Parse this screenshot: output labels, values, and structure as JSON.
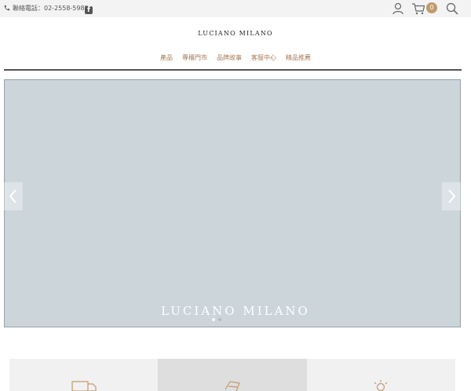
{
  "topbar": {
    "phone_label": "聯絡電話：02-2558-5985",
    "facebook_glyph": "f",
    "cart_count": "0"
  },
  "brand": {
    "logo_text": "LUCIANO MILANO"
  },
  "nav": {
    "items": [
      "產品",
      "專櫃門市",
      "品牌故事",
      "客服中心",
      "精品推薦"
    ]
  },
  "hero": {
    "overlay_text": "LUCIANO MILANO",
    "dots": 2,
    "active_dot": 1
  },
  "icons": {
    "phone": "phone-icon",
    "facebook": "facebook-icon",
    "user": "user-icon",
    "cart": "cart-icon",
    "search": "search-icon",
    "prev": "chevron-left-icon",
    "next": "chevron-right-icon",
    "card1": "truck-icon",
    "card2": "card-icon",
    "card3": "lightbulb-icon"
  },
  "colors": {
    "accent": "#a87c5a",
    "badge": "#c19a6b"
  }
}
